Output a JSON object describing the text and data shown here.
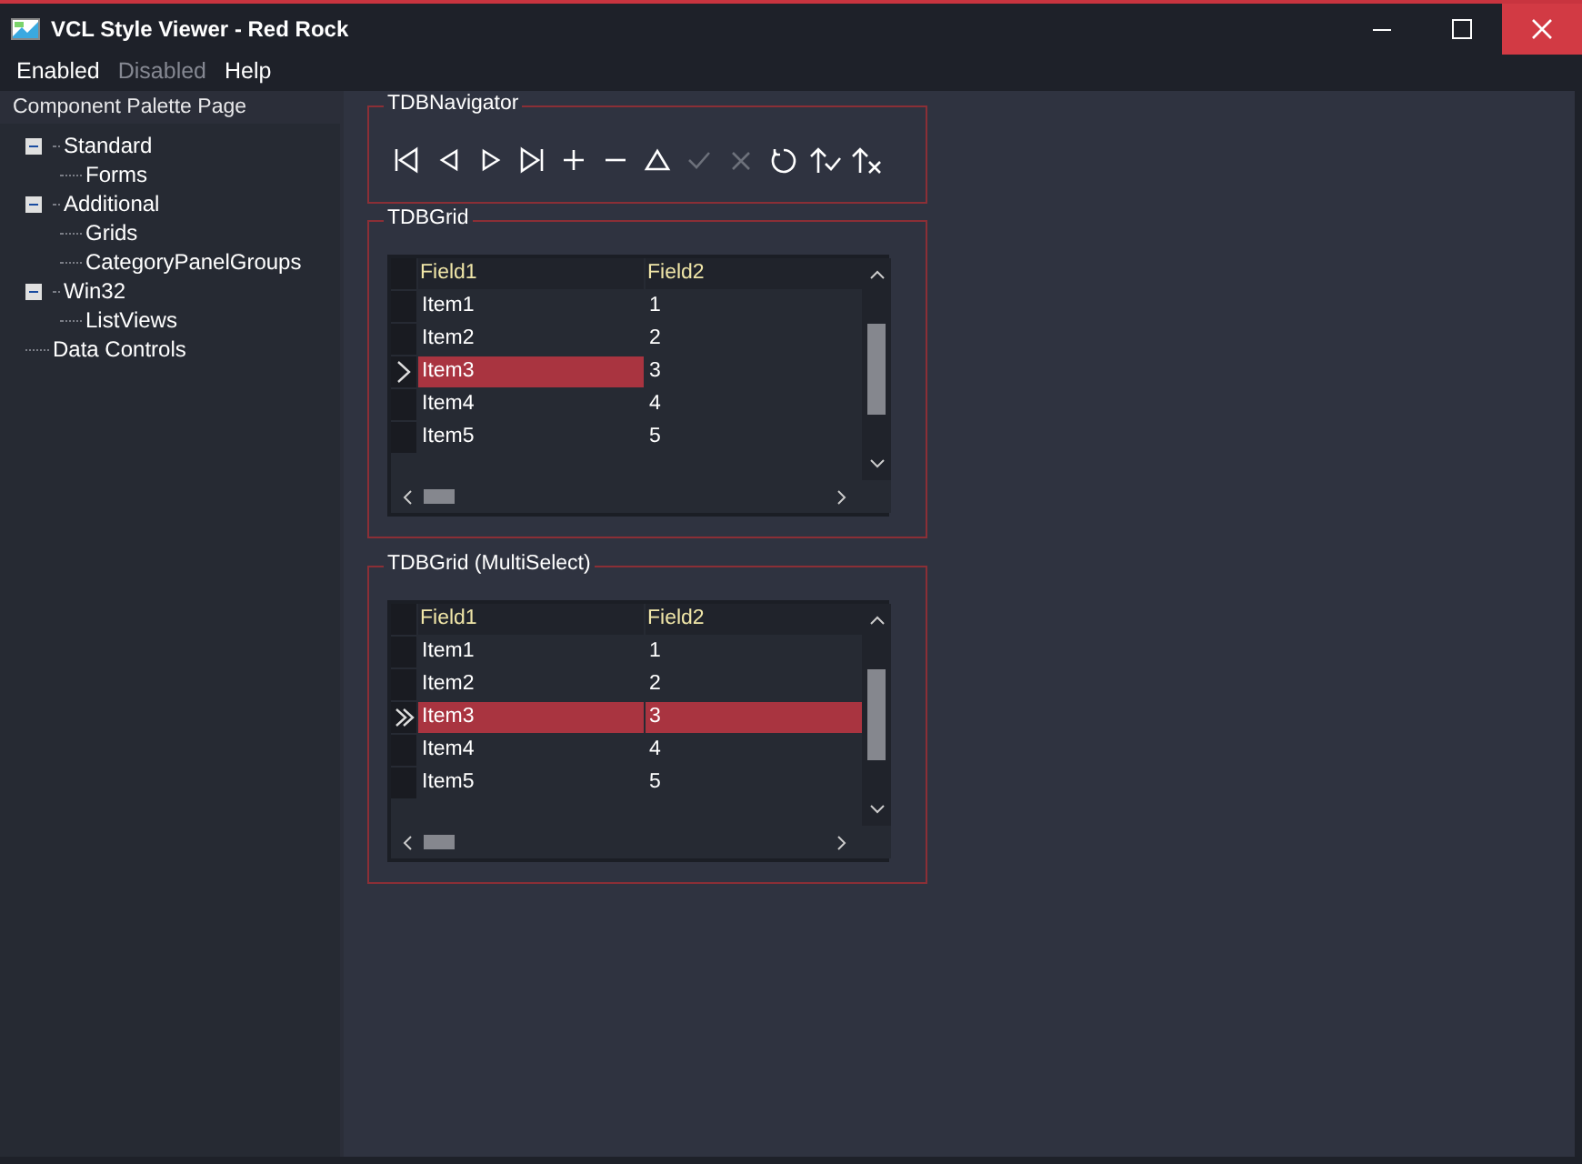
{
  "window": {
    "title": "VCL Style Viewer - Red Rock"
  },
  "menu": [
    {
      "label": "Enabled",
      "disabled": false
    },
    {
      "label": "Disabled",
      "disabled": true
    },
    {
      "label": "Help",
      "disabled": false
    }
  ],
  "sidebar": {
    "title": "Component Palette Page",
    "tree": [
      {
        "label": "Standard",
        "expanded": true,
        "children": [
          {
            "label": "Forms"
          }
        ]
      },
      {
        "label": "Additional",
        "expanded": true,
        "children": [
          {
            "label": "Grids"
          },
          {
            "label": "CategoryPanelGroups"
          }
        ]
      },
      {
        "label": "Win32",
        "expanded": true,
        "children": [
          {
            "label": "ListViews"
          }
        ]
      },
      {
        "label": "Data Controls"
      }
    ]
  },
  "navigator": {
    "title": "TDBNavigator",
    "buttons": [
      {
        "kind": "first",
        "disabled": false
      },
      {
        "kind": "prior",
        "disabled": false
      },
      {
        "kind": "next",
        "disabled": false
      },
      {
        "kind": "last",
        "disabled": false
      },
      {
        "kind": "insert",
        "disabled": false
      },
      {
        "kind": "delete",
        "disabled": false
      },
      {
        "kind": "edit",
        "disabled": false
      },
      {
        "kind": "post",
        "disabled": true
      },
      {
        "kind": "cancel",
        "disabled": true
      },
      {
        "kind": "refresh",
        "disabled": false
      },
      {
        "kind": "apply",
        "disabled": false
      },
      {
        "kind": "cancel-updates",
        "disabled": false
      }
    ]
  },
  "grids": [
    {
      "title": "TDBGrid",
      "kind": "single",
      "columns": [
        "Field1",
        "Field2"
      ],
      "rows": [
        {
          "cells": [
            "Item1",
            "1"
          ],
          "selected": false
        },
        {
          "cells": [
            "Item2",
            "2"
          ],
          "selected": false
        },
        {
          "cells": [
            "Item3",
            "3"
          ],
          "selected": true
        },
        {
          "cells": [
            "Item4",
            "4"
          ],
          "selected": false
        },
        {
          "cells": [
            "Item5",
            "5"
          ],
          "selected": false
        }
      ]
    },
    {
      "title": "TDBGrid (MultiSelect)",
      "kind": "multi",
      "columns": [
        "Field1",
        "Field2"
      ],
      "rows": [
        {
          "cells": [
            "Item1",
            "1"
          ],
          "selected": false
        },
        {
          "cells": [
            "Item2",
            "2"
          ],
          "selected": false
        },
        {
          "cells": [
            "Item3",
            "3"
          ],
          "selected": true
        },
        {
          "cells": [
            "Item4",
            "4"
          ],
          "selected": false
        },
        {
          "cells": [
            "Item5",
            "5"
          ],
          "selected": false
        }
      ]
    }
  ]
}
